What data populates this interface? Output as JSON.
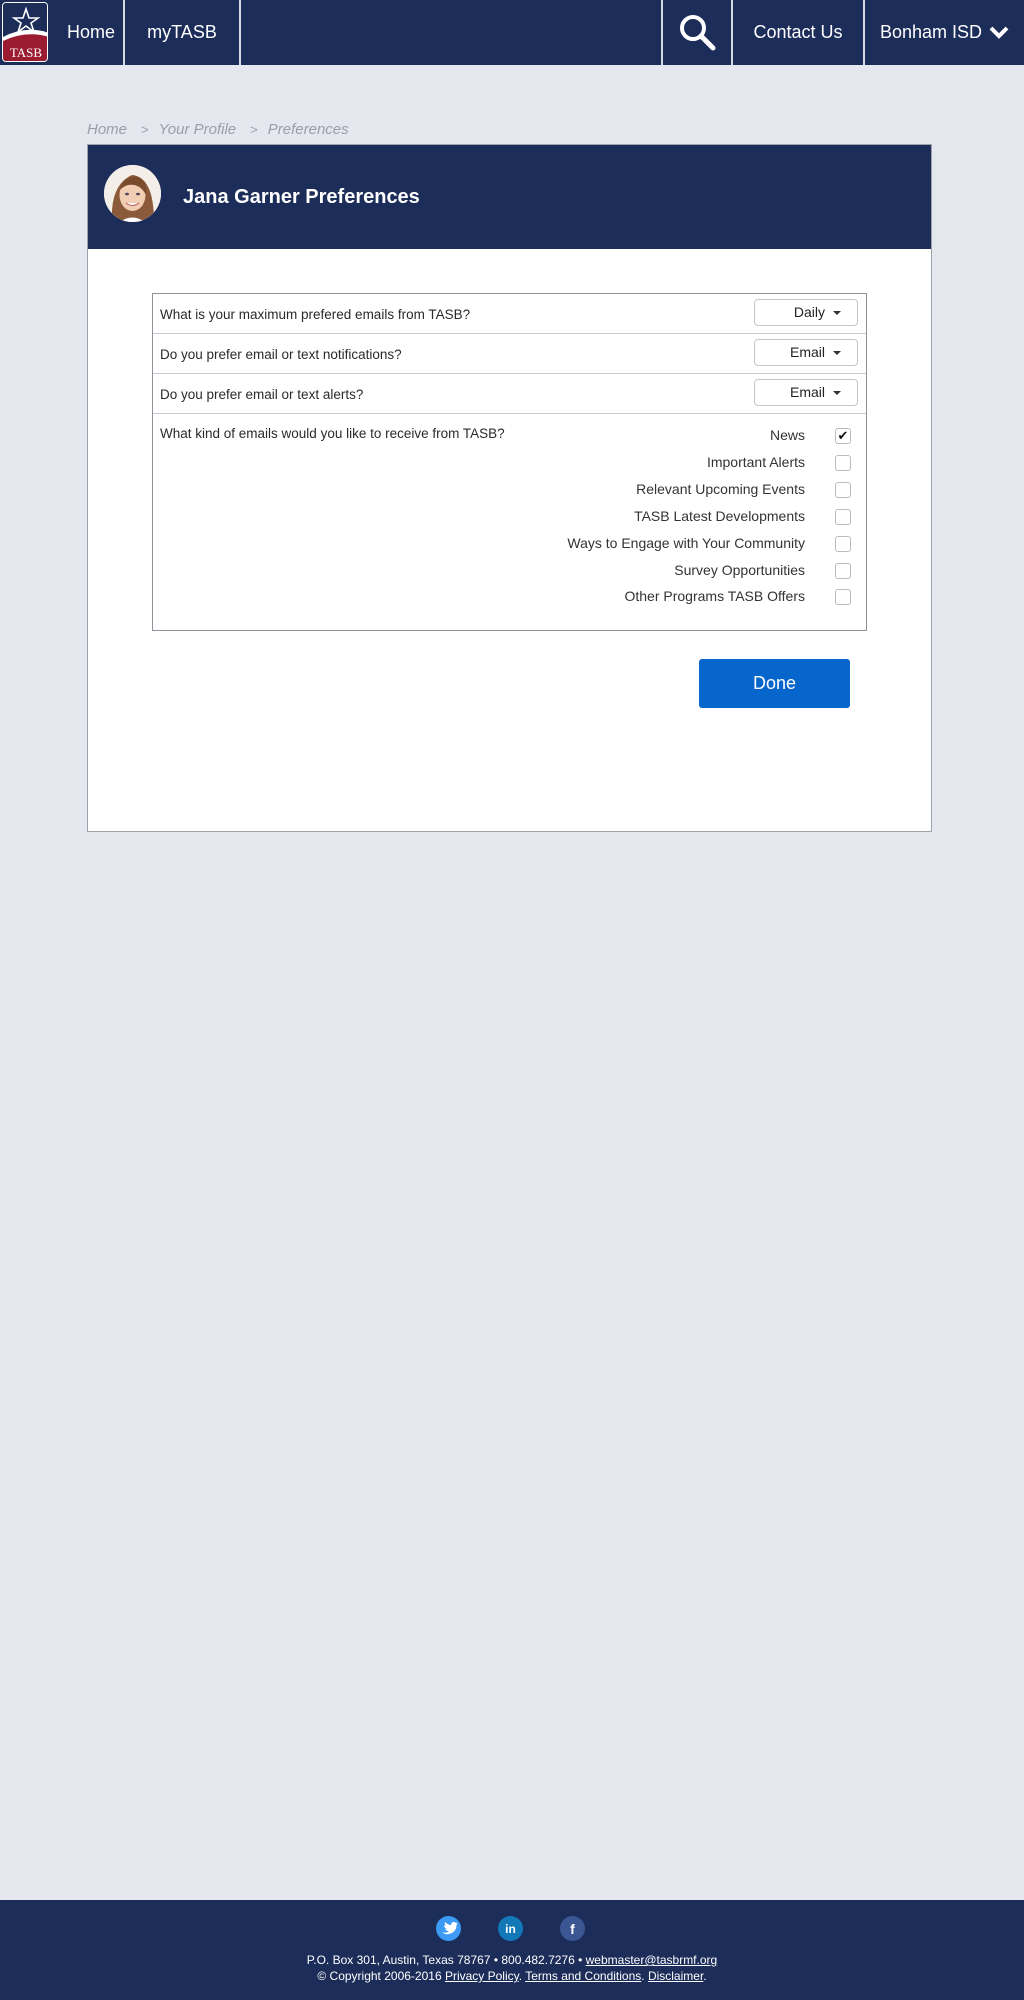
{
  "nav": {
    "logo_text": "TASB",
    "items": [
      {
        "label": "Home"
      },
      {
        "label": "myTASB"
      }
    ],
    "search_icon": "search-icon",
    "contact_label": "Contact Us",
    "district_label": "Bonham ISD",
    "district_icon": "chevron-down-icon"
  },
  "breadcrumb": [
    "Home",
    "Your Profile",
    "Preferences"
  ],
  "breadcrumb_separator": ">",
  "card": {
    "title": "Jana Garner Preferences",
    "avatar": "user-avatar"
  },
  "preferences": {
    "questions": [
      {
        "label": "What is your maximum prefered emails from TASB?",
        "value": "Daily"
      },
      {
        "label": "Do you prefer email or text notifications?",
        "value": "Email"
      },
      {
        "label": "Do you prefer email or text alerts?",
        "value": "Email"
      }
    ],
    "email_types_question": "What kind of emails would you like to receive from TASB?",
    "email_types": [
      {
        "label": "News",
        "checked": true
      },
      {
        "label": "Important Alerts",
        "checked": false
      },
      {
        "label": "Relevant Upcoming Events",
        "checked": false
      },
      {
        "label": "TASB Latest Developments",
        "checked": false
      },
      {
        "label": "Ways to Engage with Your Community",
        "checked": false
      },
      {
        "label": "Survey Opportunities",
        "checked": false
      },
      {
        "label": "Other Programs TASB Offers",
        "checked": false
      }
    ]
  },
  "done_label": "Done",
  "colors": {
    "navy": "#1c2d5a",
    "button_blue": "#0766cc",
    "page_bg": "#e4e7ee"
  },
  "footer": {
    "social": [
      "twitter-icon",
      "linkedin-icon",
      "facebook-icon"
    ],
    "address": "P.O. Box 301, Austin, Texas 78767 • 800.482.7276 • ",
    "email": "webmaster@tasbrmf.org",
    "copyright": "© Copyright 2006-2016 ",
    "privacy": "Privacy Policy",
    "terms": "Terms and Conditions",
    "disclaimer": "Disclaimer",
    "dot": ". "
  }
}
